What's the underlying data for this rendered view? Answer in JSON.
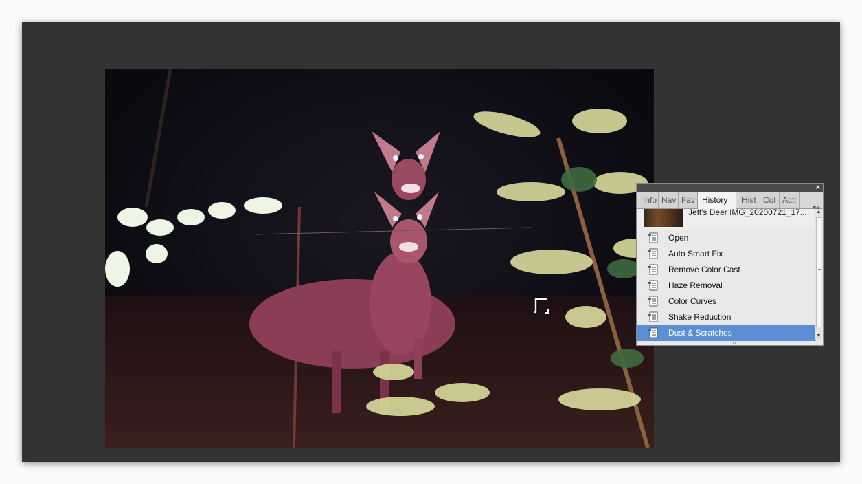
{
  "panel": {
    "close_glyph": "×",
    "menu_glyph": "▾≡",
    "tabs": [
      {
        "label": "Info"
      },
      {
        "label": "Nav"
      },
      {
        "label": "Fav"
      },
      {
        "label": "History"
      },
      {
        "label": "Hist"
      },
      {
        "label": "Col"
      },
      {
        "label": "Acti"
      }
    ],
    "active_tab": "History",
    "snapshot": {
      "label": "Jeff's Deer IMG_20200721_17..."
    },
    "history_items": [
      {
        "label": "Open"
      },
      {
        "label": "Auto Smart Fix"
      },
      {
        "label": "Remove Color Cast"
      },
      {
        "label": "Haze Removal"
      },
      {
        "label": "Color Curves"
      },
      {
        "label": "Shake Reduction"
      },
      {
        "label": "Dust & Scratches"
      }
    ],
    "selected_item": "Dust & Scratches",
    "scroll": {
      "up": "▲",
      "down": "▼"
    }
  },
  "colors": {
    "workspace": "#333333",
    "selection": "#5a8ed6",
    "panel_bg": "#e9e9e9"
  }
}
